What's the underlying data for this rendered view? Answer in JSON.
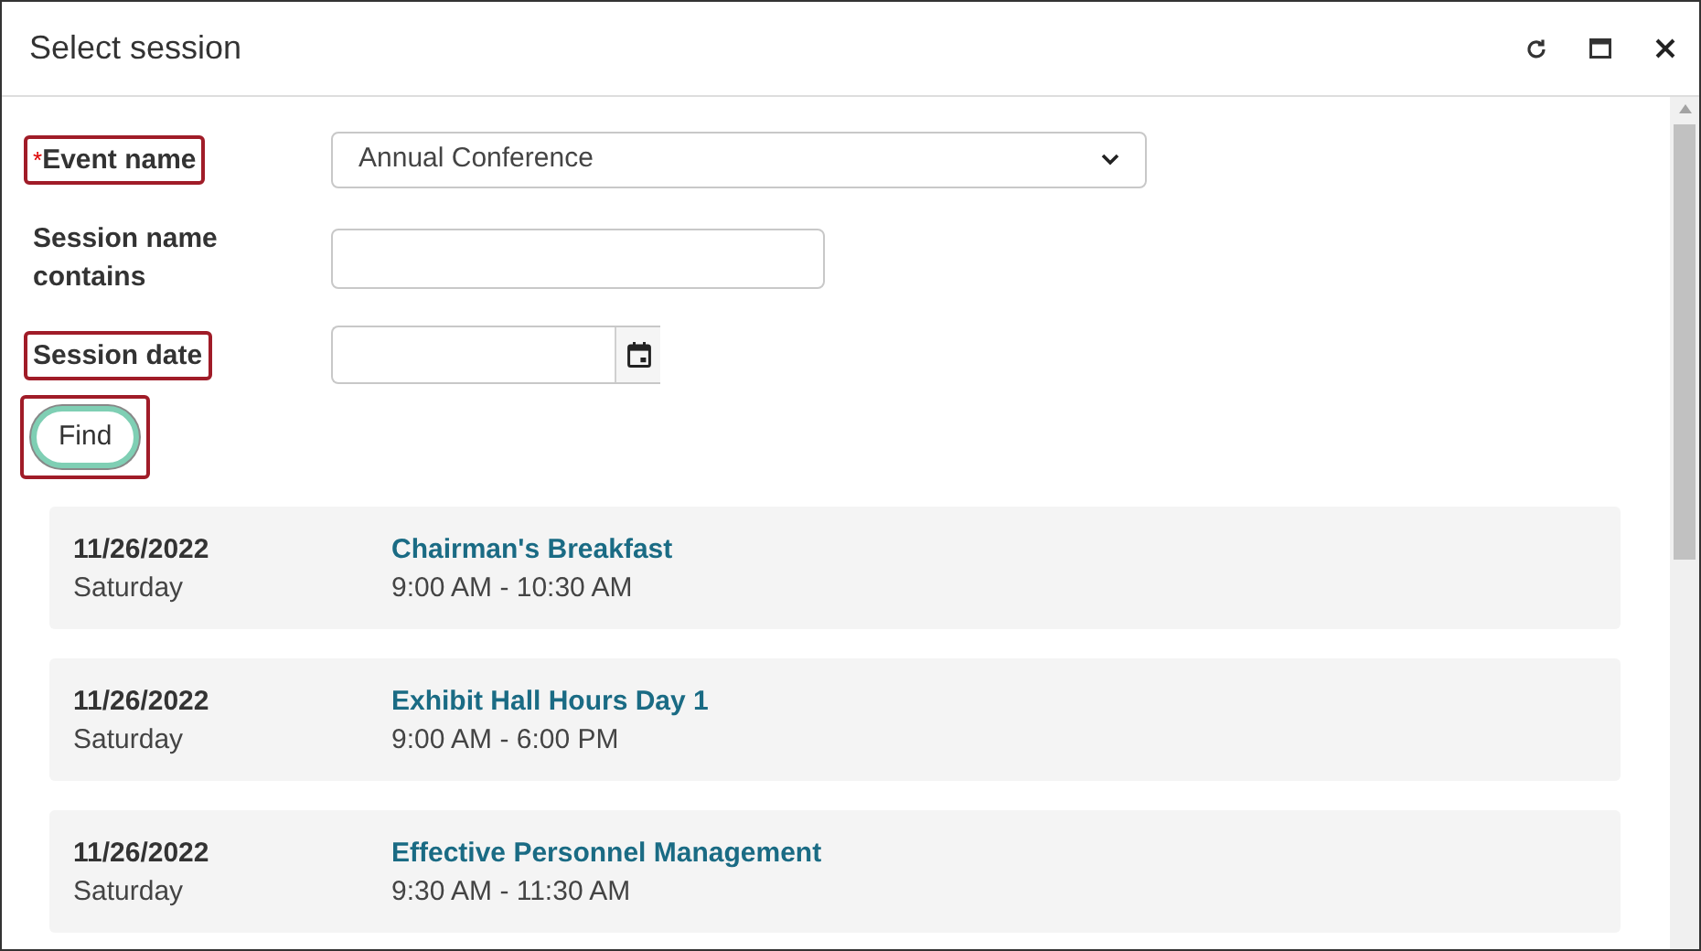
{
  "window": {
    "title": "Select session"
  },
  "title_buttons": [
    {
      "kind": "refresh"
    },
    {
      "kind": "maximize"
    },
    {
      "kind": "close"
    }
  ],
  "form": {
    "fields": [
      {
        "kind": "select",
        "label": "Event name",
        "required_mark": "*",
        "highlighted": true,
        "value": "Annual Conference"
      },
      {
        "kind": "text",
        "label": "Session name contains",
        "highlighted": false
      },
      {
        "kind": "date",
        "label": "Session date",
        "highlighted": true
      }
    ]
  },
  "find_button": {
    "label": "Find",
    "highlighted": true
  },
  "sessions": [
    {
      "date": "11/26/2022",
      "weekday": "Saturday",
      "name": "Chairman's Breakfast",
      "time": "9:00 AM - 10:30 AM"
    },
    {
      "date": "11/26/2022",
      "weekday": "Saturday",
      "name": "Exhibit Hall Hours Day 1",
      "time": "9:00 AM - 6:00 PM"
    },
    {
      "date": "11/26/2022",
      "weekday": "Saturday",
      "name": "Effective Personnel Management",
      "time": "9:30 AM - 11:30 AM"
    }
  ]
}
